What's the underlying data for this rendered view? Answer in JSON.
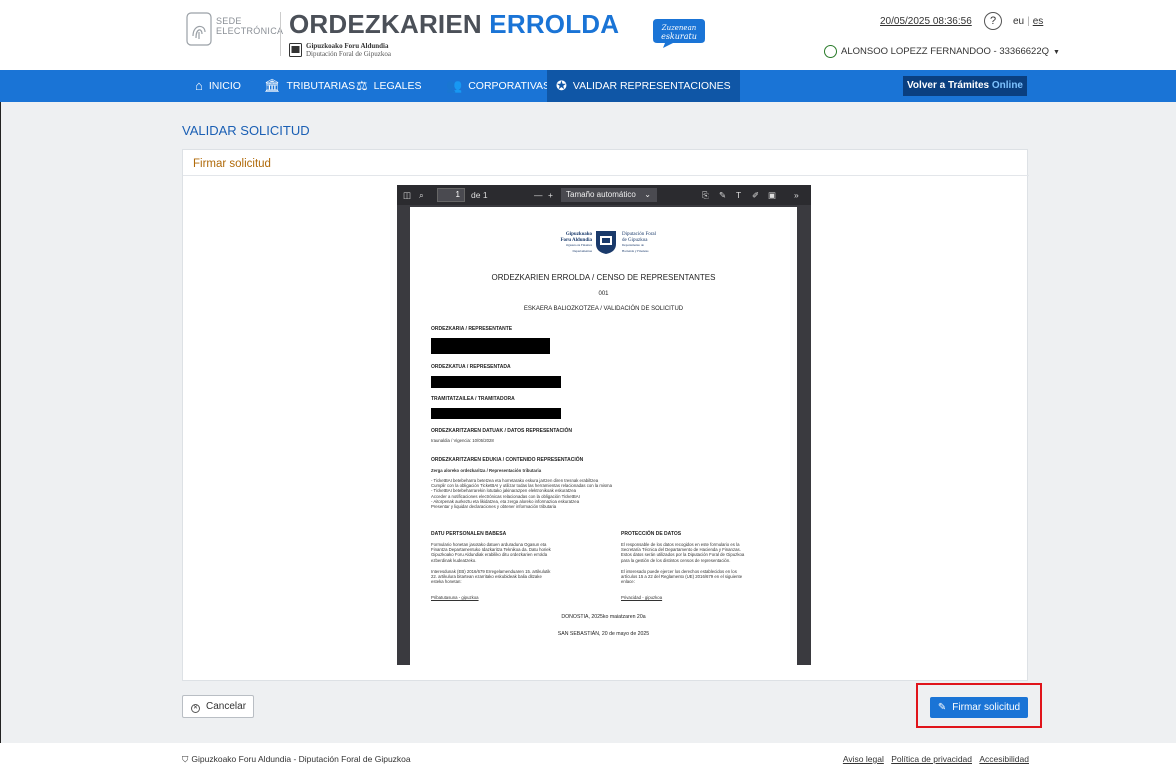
{
  "header": {
    "sede_line1": "SEDE",
    "sede_line2": "ELECTRÓNICA",
    "title_part1": "ORDEZKARIEN ",
    "title_part2": "ERROLDA",
    "org_line1": "Gipuzkoako Foru Aldundia",
    "org_line2": "Diputación Foral de Gipuzkoa",
    "badge_line1": "Zuzenean",
    "badge_line2": "eskuratu",
    "datetime": "20/05/2025  08:36:56",
    "help": "?",
    "lang_eu": "eu",
    "lang_es": "es",
    "user": "ALONSOO LOPEZZ FERNANDOO - 33366622Q",
    "accent": "#1a74d6"
  },
  "nav": {
    "items": [
      {
        "label": "INICIO",
        "icon": "home-icon"
      },
      {
        "label": "TRIBUTARIAS",
        "icon": "bank-icon"
      },
      {
        "label": "LEGALES",
        "icon": "scales-icon"
      },
      {
        "label": "CORPORATIVAS",
        "icon": "group-icon"
      },
      {
        "label": "VALIDAR REPRESENTACIONES",
        "icon": "check-badge-icon"
      }
    ],
    "back_label": "Volver a Trámites",
    "back_suffix": "Online"
  },
  "page": {
    "title": "VALIDAR SOLICITUD",
    "panel_title": "Firmar solicitud"
  },
  "viewer": {
    "page_value": "1",
    "page_total": "de 1",
    "zoom": "Tamaño automático"
  },
  "doc": {
    "logo_left_1": "Gipuzkoako",
    "logo_left_2": "Foru Aldundia",
    "logo_left_3": "Ogasun eta Finantza",
    "logo_left_4": "Departamentua",
    "logo_right_1": "Diputación Foral",
    "logo_right_2": "de Gipuzkoa",
    "logo_right_3": "Departamento de",
    "logo_right_4": "Hacienda y Finanzas",
    "title": "ORDEZKARIEN ERROLDA / CENSO DE REPRESENTANTES",
    "number": "001",
    "subtitle": "ESKAERA BALIOZKOTZEA / VALIDACIÓN DE SOLICITUD",
    "representante": "ORDEZKARIA / REPRESENTANTE",
    "representada": "ORDEZKATUA / REPRESENTADA",
    "tramitadora": "TRAMITATZAILEA / TRAMITADORA",
    "datos_rep": "ORDEZKARITZAREN DATUAK / DATOS REPRESENTACIÓN",
    "vigencia": "Iraunaldia / Vigencia: 10/05/2028",
    "contenido": "ORDEZKARITZAREN EDUKIA / CONTENIDO REPRESENTACIÓN",
    "tributaria": "Zerga aloreko ordezkaritza / Representación tributaria",
    "items": [
      "- TicketBAI betebeharra betetzea eta horretarako eskura jartzen diren tresnak erabiltzea",
      "Cumplir con la obligación TicketBAI y utilizar todas las herramientas relacionadas con la misma",
      "- TicketBAI betebeharrarekin lotutako jakinarazpen elektronikoak eskuratzea",
      "Acceder a notificaciones electrónicas relacionadas con la obligación TicketBAI",
      "- Aitorpenak aurkeztu eta likidatzea, eta zerga aloreko informazioa eskuratzea",
      "Presentar y liquidar declaraciones y obtener información tributaria"
    ],
    "col1_head": "DATU PERTSONALEN BABESA",
    "col1_p1": [
      "Formulario honetan jasotako datuen arduraduna Ogasun eta",
      "Finantza Departamentuko Idazkaritza Teknikoa da. Datu horiek",
      "Gipuzkoako Foru Aldundiak erabiliko ditu ordezkarien errolda",
      "ezberdinak kudeatzeko."
    ],
    "col1_p2": [
      "Interesdunak (EB) 2016/679 Erregelamenduaren 15. artikulutik",
      "22. artikulura bitartean ezarritako eskubideak baliа ditzake",
      "esteka honetan:"
    ],
    "col1_link": "Pribatutasuna - gipuzkoa",
    "col2_head": "PROTECCIÓN DE DATOS",
    "col2_p1": [
      "El responsable de los datos recogidos en este formulario es la",
      "Secretaría Técnica del Departamento de Hacienda y Finanzas.",
      "Estos datos serán utilizados por la Diputación Foral de Gipuzkoa",
      "para la gestión de los distintos censos de representación."
    ],
    "col2_p2": [
      "El interesado puede ejercer los derechos establecidos en los",
      "artículos 15 a 22 del Reglamento (UE) 2016/679 en el siguiente",
      "enlace:"
    ],
    "col2_link": "Privacidad - gipuzkoa",
    "place_eu": "DONOSTIA, 2025ko maiatzaren 20a",
    "place_es": "SAN SEBASTIÁN, 20 de mayo de 2025"
  },
  "actions": {
    "cancel": "Cancelar",
    "sign": "Firmar solicitud"
  },
  "footer": {
    "left": "Gipuzkoako Foru Aldundia - Diputación Foral de Gipuzkoa",
    "links": [
      "Aviso legal",
      "Política de privacidad",
      "Accesibilidad"
    ]
  }
}
